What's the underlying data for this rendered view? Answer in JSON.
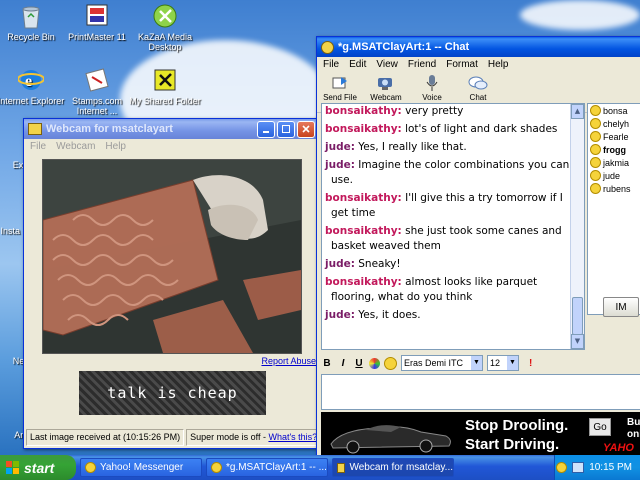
{
  "desktop": {
    "icons": [
      {
        "label": "Recycle Bin",
        "icon": "recycle-bin-icon"
      },
      {
        "label": "PrintMaster 11",
        "icon": "printmaster-icon",
        "badge": "PM 11"
      },
      {
        "label": "KaZaA Media Desktop",
        "icon": "kazaa-icon"
      },
      {
        "label": "Internet Explorer",
        "icon": "internet-explorer-icon"
      },
      {
        "label": "Stamps.com Internet ...",
        "icon": "stamps-icon"
      },
      {
        "label": "My Shared Folder",
        "icon": "shared-folder-icon"
      },
      {
        "label": "Expr",
        "icon": "partial-icon"
      },
      {
        "label": "Insta Onlin",
        "icon": "partial-icon"
      },
      {
        "label": "Nets",
        "icon": "partial-icon"
      },
      {
        "label": "Anti",
        "icon": "partial-icon"
      }
    ]
  },
  "webcam_window": {
    "title": "Webcam for msatclayart",
    "menu": [
      "File",
      "Webcam",
      "Help"
    ],
    "report_link": "Report Abuse",
    "captcha_text": "talk is cheap",
    "status_last_image": "Last image received at (10:15:26 PM)",
    "status_super_mode": "Super mode is off - ",
    "status_whats_this": "What's this?"
  },
  "chat_window": {
    "title": "*g.MSATClayArt:1 -- Chat",
    "menu": [
      "File",
      "Edit",
      "View",
      "Friend",
      "Format",
      "Help"
    ],
    "toolbar": [
      {
        "label": "Send File",
        "icon": "send-file-icon"
      },
      {
        "label": "Webcam",
        "icon": "webcam-icon"
      },
      {
        "label": "Voice",
        "icon": "microphone-icon"
      },
      {
        "label": "Chat",
        "icon": "chat-bubbles-icon"
      }
    ],
    "messages": [
      {
        "nick": "bonsaikathy:",
        "text": "very pretty"
      },
      {
        "nick": "bonsaikathy:",
        "text": "lot's of light and dark shades"
      },
      {
        "nick": "jude:",
        "text": "Yes, I really like that."
      },
      {
        "nick": "jude:",
        "text": "Imagine the color combinations you can use."
      },
      {
        "nick": "bonsaikathy:",
        "text": "I'll give this a try tomorrow if I get time"
      },
      {
        "nick": "bonsaikathy:",
        "text": "she just took some canes and basket weaved them"
      },
      {
        "nick": "jude:",
        "text": "Sneaky!"
      },
      {
        "nick": "bonsaikathy:",
        "text": "almost looks like parquet flooring, what do you think"
      },
      {
        "nick": "jude:",
        "text": "Yes, it does."
      }
    ],
    "participants": [
      "bonsa",
      "chelyh",
      "Fearle",
      "frogg",
      "jakmia",
      "jude",
      "rubens"
    ],
    "im_button": "IM",
    "format": {
      "bold": "B",
      "italic": "I",
      "underline": "U",
      "font": "Eras Demi ITC",
      "size": "12"
    },
    "ad": {
      "line1": "Stop Drooling.",
      "line2": "Start Driving.",
      "go": "Go",
      "partial_right1": "Buy",
      "partial_right2": "onl",
      "brand": "YAHO"
    }
  },
  "taskbar": {
    "start": "start",
    "tasks": [
      {
        "label": "Yahoo! Messenger",
        "icon": "yahoo-messenger-icon"
      },
      {
        "label": "*g.MSATClayArt:1 -- ...",
        "icon": "chat-icon"
      },
      {
        "label": "Webcam for msatclay...",
        "icon": "webcam-icon"
      }
    ],
    "clock": "10:15 PM"
  },
  "colors": {
    "xp_blue": "#0254e1",
    "chat_nick_other": "#c2185b",
    "chat_nick_self": "#7a1c66",
    "start_green": "#35a335"
  }
}
